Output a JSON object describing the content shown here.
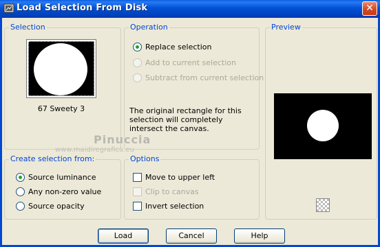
{
  "window": {
    "title": "Load Selection From Disk",
    "close_glyph": "✕"
  },
  "selection": {
    "group_label": "Selection",
    "name": "67 Sweety 3"
  },
  "operation": {
    "group_label": "Operation",
    "options": [
      {
        "label": "Replace selection",
        "checked": true,
        "enabled": true
      },
      {
        "label": "Add to current selection",
        "checked": false,
        "enabled": false
      },
      {
        "label": "Subtract from current selection",
        "checked": false,
        "enabled": false
      }
    ],
    "description": "The original rectangle for this selection will completely intersect the canvas."
  },
  "preview": {
    "group_label": "Preview"
  },
  "create_from": {
    "group_label": "Create selection from:",
    "options": [
      {
        "label": "Source luminance",
        "checked": true
      },
      {
        "label": "Any non-zero value",
        "checked": false
      },
      {
        "label": "Source opacity",
        "checked": false
      }
    ]
  },
  "options": {
    "group_label": "Options",
    "items": [
      {
        "label": "Move to upper left",
        "checked": false,
        "enabled": true
      },
      {
        "label": "Clip to canvas",
        "checked": false,
        "enabled": false
      },
      {
        "label": "Invert selection",
        "checked": false,
        "enabled": true
      }
    ]
  },
  "watermark": {
    "logo": "Pinuccia",
    "url": "www.maidiregrafica.eu"
  },
  "buttons": {
    "load": "Load",
    "cancel": "Cancel",
    "help": "Help"
  },
  "icons": {
    "app": "app-icon",
    "close": "close-icon",
    "preview_toggle": "checkerboard-icon"
  },
  "colors": {
    "title_bar": "#0052d6",
    "group_label": "#0046d5",
    "dialog_bg": "#ece9d8",
    "close_button": "#d34a25"
  }
}
